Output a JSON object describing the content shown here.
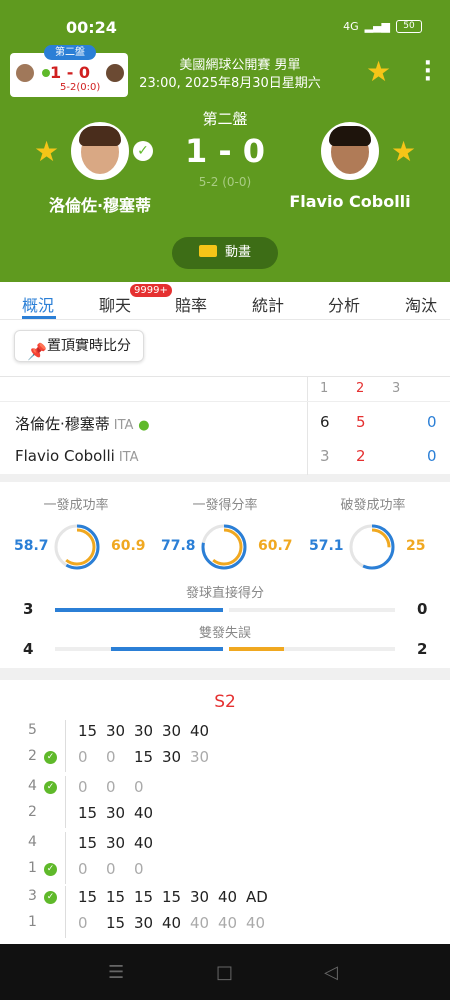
{
  "status_bar": {
    "time": "00:24",
    "network": "4G",
    "battery": "50"
  },
  "mini_card": {
    "set_tag": "第二盤",
    "score": "1 - 0",
    "sub_score": "5-2(0:0)"
  },
  "match": {
    "title": "美國網球公開賽 男單",
    "datetime": "23:00, 2025年8月30日星期六",
    "set_label": "第二盤",
    "score": "1 - 0",
    "sub_score": "5-2 (0-0)",
    "player1": "洛倫佐·穆塞蒂",
    "player2": "Flavio Cobolli",
    "animation_label": "動畫"
  },
  "tabs": [
    {
      "label": "概況",
      "active": true
    },
    {
      "label": "聊天",
      "badge": "9999+"
    },
    {
      "label": "賠率"
    },
    {
      "label": "統計"
    },
    {
      "label": "分析"
    },
    {
      "label": "淘汰賽"
    }
  ],
  "pin_button": "置頂實時比分",
  "scoreboard": {
    "headers": [
      "1",
      "2",
      "3"
    ],
    "rows": [
      {
        "name": "洛倫佐·穆塞蒂",
        "country": "ITA",
        "serving": true,
        "sets": [
          "6",
          "5",
          "0"
        ]
      },
      {
        "name": "Flavio Cobolli",
        "country": "ITA",
        "serving": false,
        "sets": [
          "3",
          "2",
          "0"
        ]
      }
    ]
  },
  "stats": {
    "rings": [
      {
        "title": "一發成功率",
        "left": "58.7",
        "right": "60.9"
      },
      {
        "title": "一發得分率",
        "left": "77.8",
        "right": "60.7"
      },
      {
        "title": "破發成功率",
        "left": "57.1",
        "right": "25"
      }
    ],
    "bars": [
      {
        "title": "發球直接得分",
        "left": "3",
        "right": "0"
      },
      {
        "title": "雙發失誤",
        "left": "4",
        "right": "2"
      }
    ]
  },
  "game_log": {
    "set_label": "S2",
    "games": [
      {
        "top_games": "5",
        "bottom_games": "2",
        "server": "bottom",
        "top_points": [
          "15",
          "30",
          "30",
          "30",
          "40"
        ],
        "bottom_points": [
          "0",
          "0",
          "15",
          "30",
          "30"
        ]
      },
      {
        "top_games": "4",
        "bottom_games": "2",
        "server": "top",
        "top_points": [
          "0",
          "0",
          "0"
        ],
        "bottom_points": [
          "15",
          "30",
          "40"
        ]
      },
      {
        "top_games": "4",
        "bottom_games": "1",
        "server": "bottom",
        "top_points": [
          "15",
          "30",
          "40"
        ],
        "bottom_points": [
          "0",
          "0",
          "0"
        ]
      },
      {
        "top_games": "3",
        "bottom_games": "1",
        "server": "top",
        "top_points": [
          "15",
          "15",
          "15",
          "15",
          "30",
          "40",
          "AD"
        ],
        "bottom_points": [
          "0",
          "15",
          "30",
          "40",
          "40",
          "40",
          "40"
        ]
      }
    ]
  },
  "colors": {
    "header_green": "#5f9a1f",
    "accent_blue": "#2b7fd6",
    "accent_orange": "#f0a820",
    "live_red": "#e53030"
  }
}
